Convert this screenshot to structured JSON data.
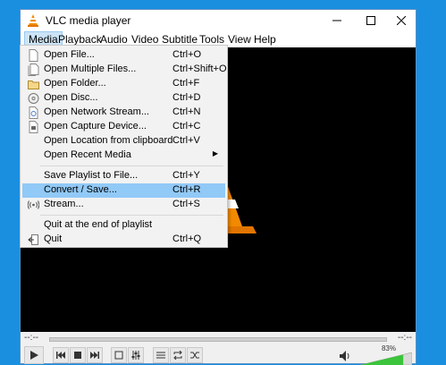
{
  "window": {
    "title": "VLC media player",
    "icon": "vlc-cone-icon"
  },
  "menubar": [
    "Media",
    "Playback",
    "Audio",
    "Video",
    "Subtitle",
    "Tools",
    "View",
    "Help"
  ],
  "media_menu": [
    {
      "label": "Open File...",
      "shortcut": "Ctrl+O",
      "icon": "file-icon"
    },
    {
      "label": "Open Multiple Files...",
      "shortcut": "Ctrl+Shift+O",
      "icon": "files-icon"
    },
    {
      "label": "Open Folder...",
      "shortcut": "Ctrl+F",
      "icon": "folder-icon"
    },
    {
      "label": "Open Disc...",
      "shortcut": "Ctrl+D",
      "icon": "disc-icon"
    },
    {
      "label": "Open Network Stream...",
      "shortcut": "Ctrl+N",
      "icon": "network-icon"
    },
    {
      "label": "Open Capture Device...",
      "shortcut": "Ctrl+C",
      "icon": "capture-icon"
    },
    {
      "label": "Open Location from clipboard",
      "shortcut": "Ctrl+V",
      "icon": ""
    },
    {
      "label": "Open Recent Media",
      "shortcut": "",
      "icon": "",
      "submenu": true
    },
    {
      "label": "Save Playlist to File...",
      "shortcut": "Ctrl+Y",
      "icon": ""
    },
    {
      "label": "Convert / Save...",
      "shortcut": "Ctrl+R",
      "icon": "",
      "highlighted": true
    },
    {
      "label": "Stream...",
      "shortcut": "Ctrl+S",
      "icon": "stream-icon"
    },
    {
      "label": "Quit at the end of playlist",
      "shortcut": "",
      "icon": ""
    },
    {
      "label": "Quit",
      "shortcut": "Ctrl+Q",
      "icon": "quit-icon"
    }
  ],
  "player": {
    "elapsed": "--:--",
    "remaining": "--:--",
    "volume_label": "83%",
    "volume": 0.83
  },
  "colors": {
    "desktop": "#1a8fe0",
    "highlight": "#91c9f7",
    "volume_fill": "#3cc43c"
  }
}
